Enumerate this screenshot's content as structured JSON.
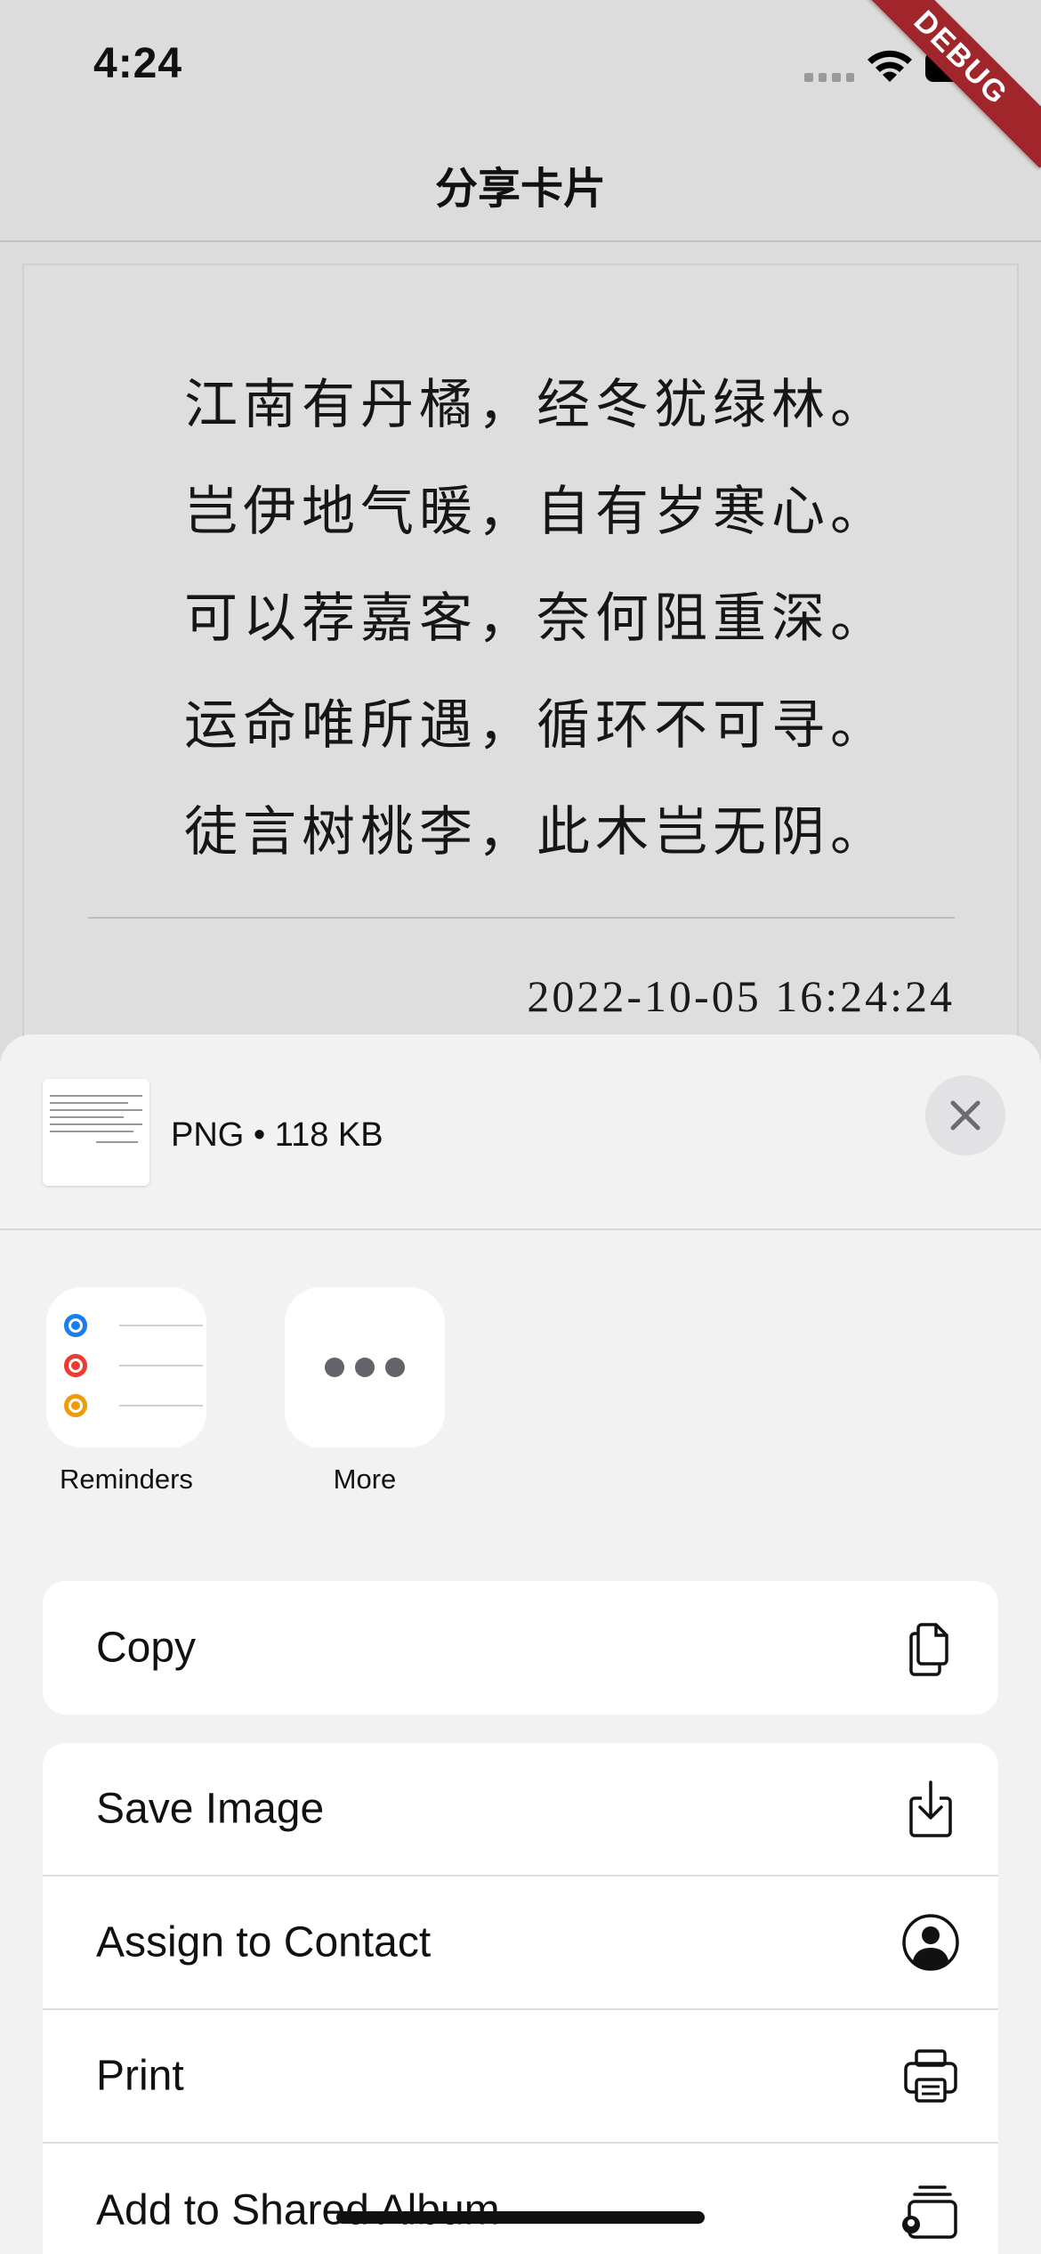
{
  "status_bar": {
    "time": "4:24"
  },
  "debug_banner": "DEBUG",
  "nav": {
    "title": "分享卡片"
  },
  "card": {
    "lines": [
      "江南有丹橘，经冬犹绿林。",
      "岂伊地气暖，自有岁寒心。",
      "可以荐嘉客，奈何阻重深。",
      "运命唯所遇，循环不可寻。",
      "徒言树桃李，此木岂无阴。"
    ],
    "date": "2022-10-05 16:24:24"
  },
  "share_sheet": {
    "file_info": "PNG • 118 KB",
    "apps": [
      {
        "label": "Reminders",
        "icon": "reminders-icon"
      },
      {
        "label": "More",
        "icon": "more-icon"
      }
    ],
    "actions_group1": [
      {
        "label": "Copy",
        "icon": "copy-icon"
      }
    ],
    "actions_group2": [
      {
        "label": "Save Image",
        "icon": "save-image-icon"
      },
      {
        "label": "Assign to Contact",
        "icon": "contact-icon"
      },
      {
        "label": "Print",
        "icon": "print-icon"
      },
      {
        "label": "Add to Shared Album",
        "icon": "shared-album-icon"
      }
    ]
  },
  "colors": {
    "reminder_blue": "#1a7cf2",
    "reminder_red": "#ee3b30",
    "reminder_orange": "#f19a09",
    "debug_red": "#a0262b"
  }
}
